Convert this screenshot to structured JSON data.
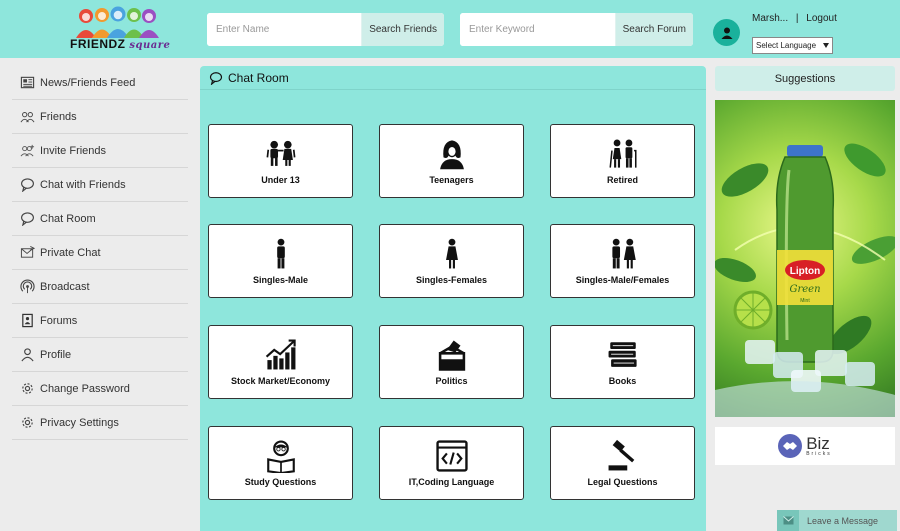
{
  "header": {
    "logo": {
      "text_main": "FRIENDZ",
      "text_sub": "square"
    },
    "search_friends": {
      "placeholder": "Enter Name",
      "button": "Search Friends"
    },
    "search_forum": {
      "placeholder": "Enter Keyword",
      "button": "Search Forum"
    },
    "user": {
      "name": "Marsh...",
      "separator": "|",
      "logout": "Logout"
    },
    "language_select": {
      "selected": "Select Language"
    }
  },
  "sidebar": {
    "items": [
      {
        "label": "News/Friends Feed",
        "icon": "newspaper-icon"
      },
      {
        "label": "Friends",
        "icon": "friends-icon"
      },
      {
        "label": "Invite Friends",
        "icon": "invite-icon"
      },
      {
        "label": "Chat with Friends",
        "icon": "chat-bubble-icon"
      },
      {
        "label": "Chat Room",
        "icon": "chat-bubble-icon"
      },
      {
        "label": "Private Chat",
        "icon": "envelope-icon"
      },
      {
        "label": "Broadcast",
        "icon": "broadcast-icon"
      },
      {
        "label": "Forums",
        "icon": "forum-icon"
      },
      {
        "label": "Profile",
        "icon": "user-icon"
      },
      {
        "label": "Change Password",
        "icon": "gear-icon"
      },
      {
        "label": "Privacy Settings",
        "icon": "gear-icon"
      }
    ]
  },
  "main": {
    "title": "Chat Room",
    "rooms": [
      {
        "label": "Under 13",
        "icon": "children-icon"
      },
      {
        "label": "Teenagers",
        "icon": "teen-girl-icon"
      },
      {
        "label": "Retired",
        "icon": "elderly-couple-icon"
      },
      {
        "label": "Singles-Male",
        "icon": "male-icon"
      },
      {
        "label": "Singles-Females",
        "icon": "female-icon"
      },
      {
        "label": "Singles-Male/Females",
        "icon": "couple-icon"
      },
      {
        "label": "Stock Market/Economy",
        "icon": "stock-chart-icon"
      },
      {
        "label": "Politics",
        "icon": "ballot-box-icon"
      },
      {
        "label": "Books",
        "icon": "books-icon"
      },
      {
        "label": "Study Questions",
        "icon": "student-reading-icon"
      },
      {
        "label": "IT,Coding Language",
        "icon": "code-window-icon"
      },
      {
        "label": "Legal Questions",
        "icon": "gavel-icon"
      }
    ]
  },
  "right": {
    "suggestions_title": "Suggestions",
    "ad_brand": "Lipton",
    "ad_product": "Green",
    "ad_variant": "Mint",
    "biz_name": "Biz",
    "biz_sub": "Bricks"
  },
  "footer": {
    "leave_message": "Leave a Message"
  },
  "colors": {
    "accent": "#8ee6dc",
    "accent_light": "#cfeee9",
    "avatar": "#1ab19c"
  }
}
